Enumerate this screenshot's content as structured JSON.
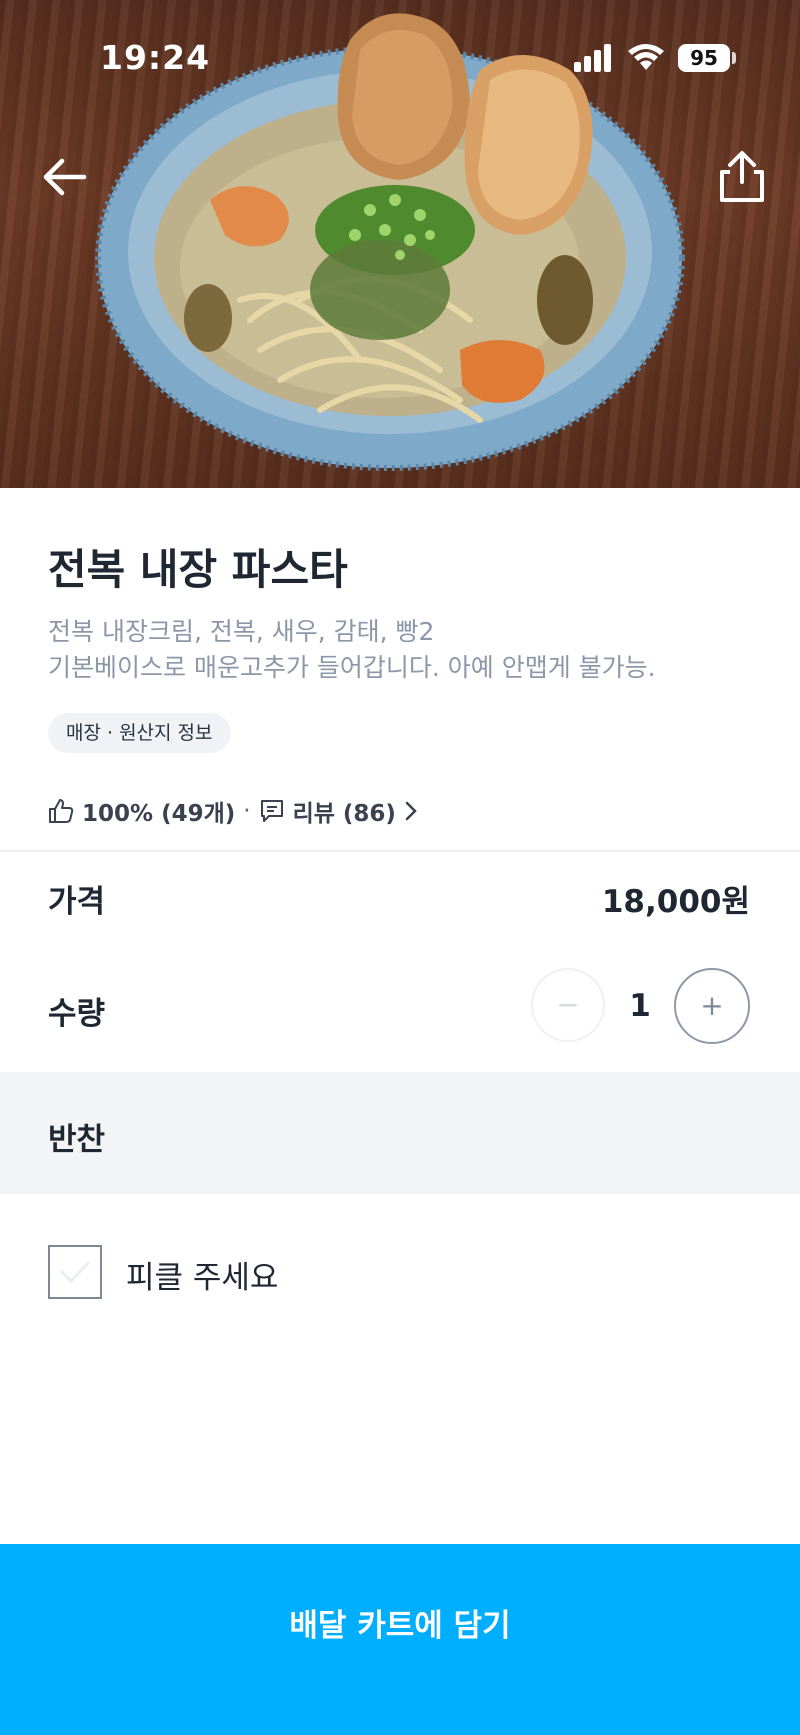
{
  "status_bar": {
    "time": "19:24",
    "battery": "95"
  },
  "header": {
    "back_icon": "arrow-left-icon",
    "share_icon": "share-icon"
  },
  "product": {
    "title": "전복 내장 파스타",
    "description_line1": "전복 내장크림, 전복, 새우, 감태, 빵2",
    "description_line2": "기본베이스로 매운고추가 들어갑니다. 아예 안맵게 불가능.",
    "info_chip": "매장 · 원산지 정보",
    "rating": "100% (49개)",
    "separator": "·",
    "reviews": "리뷰 (86)"
  },
  "price": {
    "label": "가격",
    "value": "18,000원"
  },
  "quantity": {
    "label": "수량",
    "value": "1",
    "minus": "−",
    "plus": "+"
  },
  "options": {
    "section_title": "반찬",
    "items": [
      {
        "label": "피클 주세요",
        "checked": false
      }
    ]
  },
  "cta": {
    "label": "배달 카트에 담기"
  },
  "colors": {
    "accent": "#00aeff",
    "text": "#1f2733",
    "muted": "#8c98a8"
  }
}
